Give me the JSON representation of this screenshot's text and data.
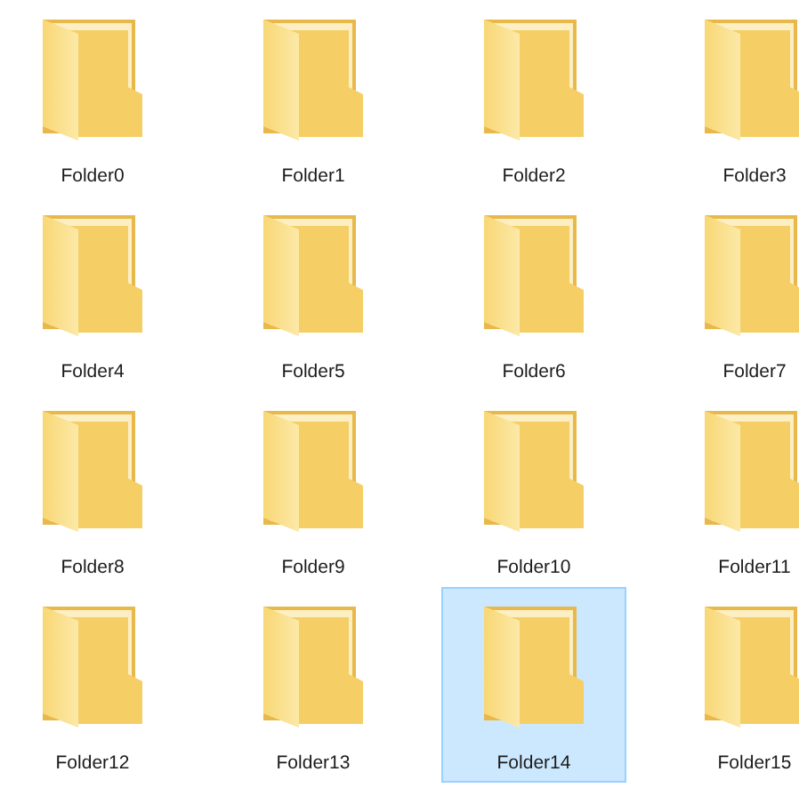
{
  "folders": [
    {
      "name": "Folder0",
      "selected": false
    },
    {
      "name": "Folder1",
      "selected": false
    },
    {
      "name": "Folder2",
      "selected": false
    },
    {
      "name": "Folder3",
      "selected": false
    },
    {
      "name": "Folder4",
      "selected": false
    },
    {
      "name": "Folder5",
      "selected": false
    },
    {
      "name": "Folder6",
      "selected": false
    },
    {
      "name": "Folder7",
      "selected": false
    },
    {
      "name": "Folder8",
      "selected": false
    },
    {
      "name": "Folder9",
      "selected": false
    },
    {
      "name": "Folder10",
      "selected": false
    },
    {
      "name": "Folder11",
      "selected": false
    },
    {
      "name": "Folder12",
      "selected": false
    },
    {
      "name": "Folder13",
      "selected": false
    },
    {
      "name": "Folder14",
      "selected": true
    },
    {
      "name": "Folder15",
      "selected": false
    }
  ]
}
